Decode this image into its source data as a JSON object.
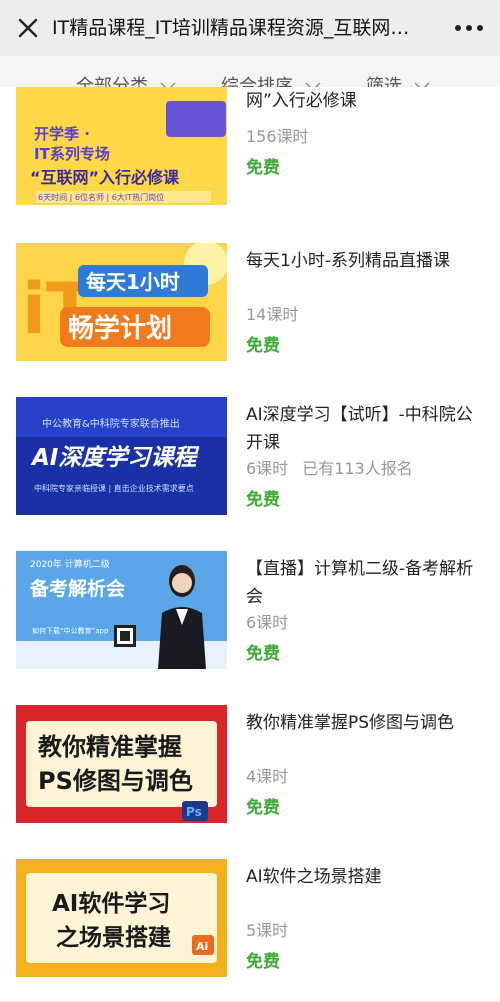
{
  "header": {
    "title": "IT精品课程_IT培训精品课程资源_互联网…",
    "close_icon": "close-icon",
    "more_icon": "more-icon"
  },
  "filters": [
    {
      "label": "全部分类"
    },
    {
      "label": "综合排序"
    },
    {
      "label": "筛选"
    }
  ],
  "courses": [
    {
      "title": "网”入行必修课",
      "lessons": "156课时",
      "enrolled": "",
      "price": "免费",
      "thumb": {
        "line1": "开学季 ·",
        "line2": "IT系列专场",
        "line3": "“互联网”入行必修课",
        "line4": "6天时间  |  6位名师  |  6大IT热门岗位"
      }
    },
    {
      "title": "每天1小时-系列精品直播课",
      "lessons": "14课时",
      "enrolled": "",
      "price": "免费",
      "thumb": {
        "line1": "每天1小时",
        "line2": "畅学计划",
        "big": "iT"
      }
    },
    {
      "title": "AI深度学习【试听】-中科院公开课",
      "lessons": "6课时",
      "enrolled": "已有113人报名",
      "price": "免费",
      "thumb": {
        "line1": "中公教育&中科院专家联合推出",
        "line2": "AI深度学习课程",
        "line3": "中科院专家亲临授课 | 直击企业技术需求要点"
      }
    },
    {
      "title": "【直播】计算机二级-备考解析会",
      "lessons": "6课时",
      "enrolled": "",
      "price": "免费",
      "thumb": {
        "line1": "2020年 计算机二级",
        "line2": "备考解析会",
        "line3": "如何下载“中公教育”app"
      }
    },
    {
      "title": "教你精准掌握PS修图与调色",
      "lessons": "4课时",
      "enrolled": "",
      "price": "免费",
      "thumb": {
        "line1": "教你精准掌握",
        "line2": "PS修图与调色",
        "badge": "Ps"
      }
    },
    {
      "title": "AI软件之场景搭建",
      "lessons": "5课时",
      "enrolled": "",
      "price": "免费",
      "thumb": {
        "line1": "AI软件学习",
        "line2": "之场景搭建",
        "badge": "Ai"
      }
    }
  ]
}
